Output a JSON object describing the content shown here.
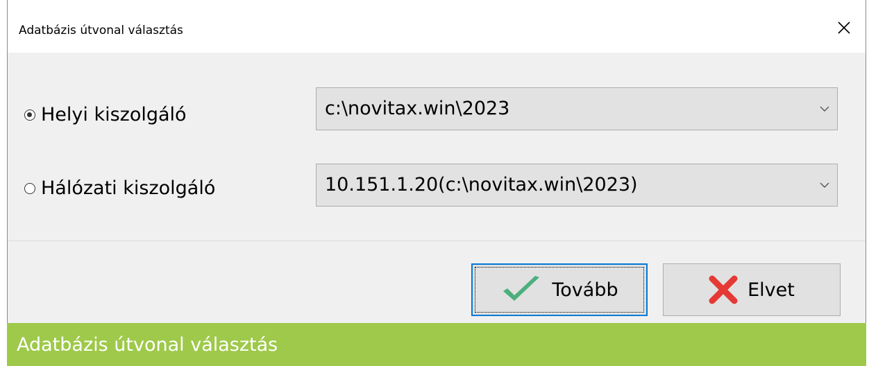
{
  "window": {
    "title": "Adatbázis útvonal választás",
    "close_icon": "close-icon"
  },
  "options": [
    {
      "label": "Helyi kiszolgáló",
      "checked": true,
      "path": "c:\\novitax.win\\2023"
    },
    {
      "label": "Hálózati kiszolgáló",
      "checked": false,
      "path": "10.151.1.20(c:\\novitax.win\\2023)"
    }
  ],
  "buttons": {
    "ok_label": "Tovább",
    "ok_icon": "checkmark-icon",
    "cancel_label": "Elvet",
    "cancel_icon": "x-mark-icon"
  },
  "caption": {
    "text": "Adatbázis útvonal választás",
    "color": "#9ec94a"
  },
  "colors": {
    "ok_icon": "#4caf7d",
    "cancel_icon": "#e53935",
    "focus_border": "#0078d7"
  }
}
